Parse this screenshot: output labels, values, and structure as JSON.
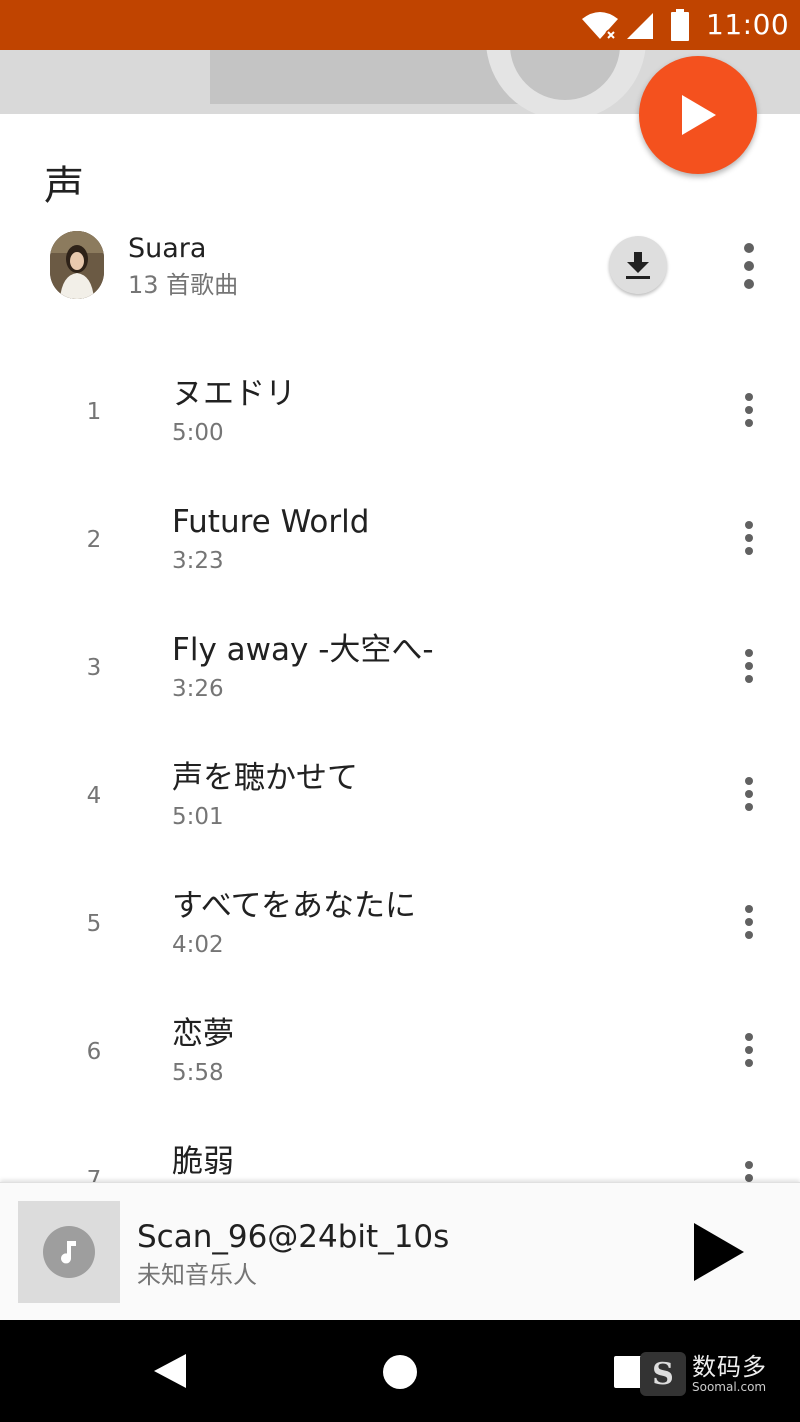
{
  "status_bar": {
    "time": "11:00",
    "icons": [
      "wifi-icon",
      "signal-icon",
      "battery-icon"
    ],
    "color": "#c04400"
  },
  "album": {
    "title": "声",
    "artist": "Suara",
    "song_count": "13 首歌曲",
    "accent_color": "#f4511e"
  },
  "tracks": [
    {
      "number": "1",
      "title": "ヌエドリ",
      "duration": "5:00"
    },
    {
      "number": "2",
      "title": "Future World",
      "duration": "3:23"
    },
    {
      "number": "3",
      "title": "Fly away -大空へ-",
      "duration": "3:26"
    },
    {
      "number": "4",
      "title": "声を聴かせて",
      "duration": "5:01"
    },
    {
      "number": "5",
      "title": "すべてをあなたに",
      "duration": "4:02"
    },
    {
      "number": "6",
      "title": "恋夢",
      "duration": "5:58"
    },
    {
      "number": "7",
      "title": "脆弱",
      "duration": ""
    }
  ],
  "now_playing": {
    "title": "Scan_96@24bit_10s",
    "artist": "未知音乐人"
  },
  "watermark": {
    "name_cn": "数码多",
    "name_en": "Soomal.com",
    "logo_letter": "S"
  }
}
